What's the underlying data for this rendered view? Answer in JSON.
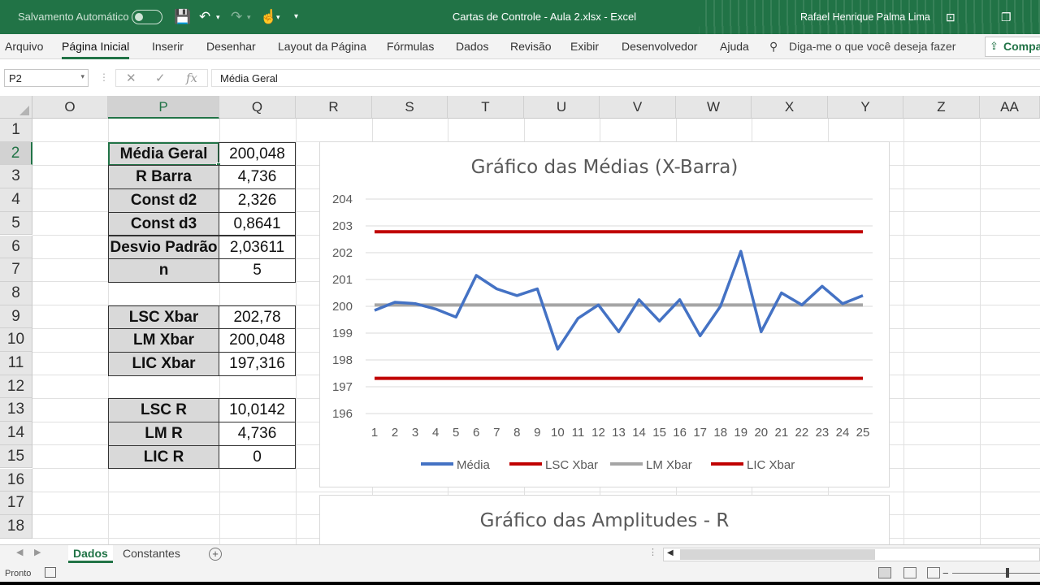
{
  "titlebar": {
    "autosave_label": "Salvamento Automático",
    "doc_title": "Cartas de Controle - Aula 2.xlsx  -  Excel",
    "user_name": "Rafael Henrique Palma Lima"
  },
  "ribbon": {
    "tabs": [
      "Arquivo",
      "Página Inicial",
      "Inserir",
      "Desenhar",
      "Layout da Página",
      "Fórmulas",
      "Dados",
      "Revisão",
      "Exibir",
      "Desenvolvedor",
      "Ajuda"
    ],
    "active_tab": "Página Inicial",
    "tell_me": "Diga-me o que você deseja fazer",
    "share_label": "Compa"
  },
  "formula_bar": {
    "name_box": "P2",
    "formula": "Média Geral"
  },
  "columns": [
    "O",
    "P",
    "Q",
    "R",
    "S",
    "T",
    "U",
    "V",
    "W",
    "X",
    "Y",
    "Z",
    "AA"
  ],
  "selected_column": "P",
  "rows": [
    "1",
    "2",
    "3",
    "4",
    "5",
    "6",
    "7",
    "8",
    "9",
    "10",
    "11",
    "12",
    "13",
    "14",
    "15",
    "16",
    "17",
    "18"
  ],
  "selected_row": "2",
  "table": [
    {
      "label": "Média Geral",
      "value": "200,048"
    },
    {
      "label": "R Barra",
      "value": "4,736"
    },
    {
      "label": "Const d2",
      "value": "2,326"
    },
    {
      "label": "Const d3",
      "value": "0,8641"
    },
    {
      "label": "Desvio Padrão",
      "value": "2,03611"
    },
    {
      "label": "n",
      "value": "5"
    },
    {
      "label": "LSC Xbar",
      "value": "202,78"
    },
    {
      "label": "LM Xbar",
      "value": "200,048"
    },
    {
      "label": "LIC Xbar",
      "value": "197,316"
    },
    {
      "label": "LSC R",
      "value": "10,0142"
    },
    {
      "label": "LM R",
      "value": "4,736"
    },
    {
      "label": "LIC R",
      "value": "0"
    }
  ],
  "chart_data": [
    {
      "type": "line",
      "title": "Gráfico das Médias (X-Barra)",
      "categories": [
        "1",
        "2",
        "3",
        "4",
        "5",
        "6",
        "7",
        "8",
        "9",
        "10",
        "11",
        "12",
        "13",
        "14",
        "15",
        "16",
        "17",
        "18",
        "19",
        "20",
        "21",
        "22",
        "23",
        "24",
        "25"
      ],
      "ylim": [
        196,
        204
      ],
      "yticks": [
        "196",
        "197",
        "198",
        "199",
        "200",
        "201",
        "202",
        "203",
        "204"
      ],
      "grid": true,
      "legend_position": "bottom",
      "series": [
        {
          "name": "Média",
          "color": "#4472c4",
          "values": [
            199.85,
            200.15,
            200.1,
            199.9,
            199.6,
            201.15,
            200.65,
            200.4,
            200.65,
            198.4,
            199.55,
            200.05,
            199.05,
            200.25,
            199.45,
            200.25,
            198.9,
            200.0,
            202.05,
            199.05,
            200.5,
            200.05,
            200.75,
            200.1,
            200.4
          ]
        },
        {
          "name": "LSC Xbar",
          "color": "#c00000",
          "values": [
            202.78,
            202.78,
            202.78,
            202.78,
            202.78,
            202.78,
            202.78,
            202.78,
            202.78,
            202.78,
            202.78,
            202.78,
            202.78,
            202.78,
            202.78,
            202.78,
            202.78,
            202.78,
            202.78,
            202.78,
            202.78,
            202.78,
            202.78,
            202.78,
            202.78
          ]
        },
        {
          "name": "LM Xbar",
          "color": "#a5a5a5",
          "values": [
            200.048,
            200.048,
            200.048,
            200.048,
            200.048,
            200.048,
            200.048,
            200.048,
            200.048,
            200.048,
            200.048,
            200.048,
            200.048,
            200.048,
            200.048,
            200.048,
            200.048,
            200.048,
            200.048,
            200.048,
            200.048,
            200.048,
            200.048,
            200.048,
            200.048
          ]
        },
        {
          "name": "LIC Xbar",
          "color": "#c00000",
          "values": [
            197.316,
            197.316,
            197.316,
            197.316,
            197.316,
            197.316,
            197.316,
            197.316,
            197.316,
            197.316,
            197.316,
            197.316,
            197.316,
            197.316,
            197.316,
            197.316,
            197.316,
            197.316,
            197.316,
            197.316,
            197.316,
            197.316,
            197.316,
            197.316,
            197.316
          ]
        }
      ]
    },
    {
      "type": "line",
      "title": "Gráfico das Amplitudes - R"
    }
  ],
  "sheets": [
    "Dados",
    "Constantes"
  ],
  "active_sheet": "Dados",
  "status": {
    "ready": "Pronto"
  },
  "colors": {
    "excel_green": "#217346"
  }
}
